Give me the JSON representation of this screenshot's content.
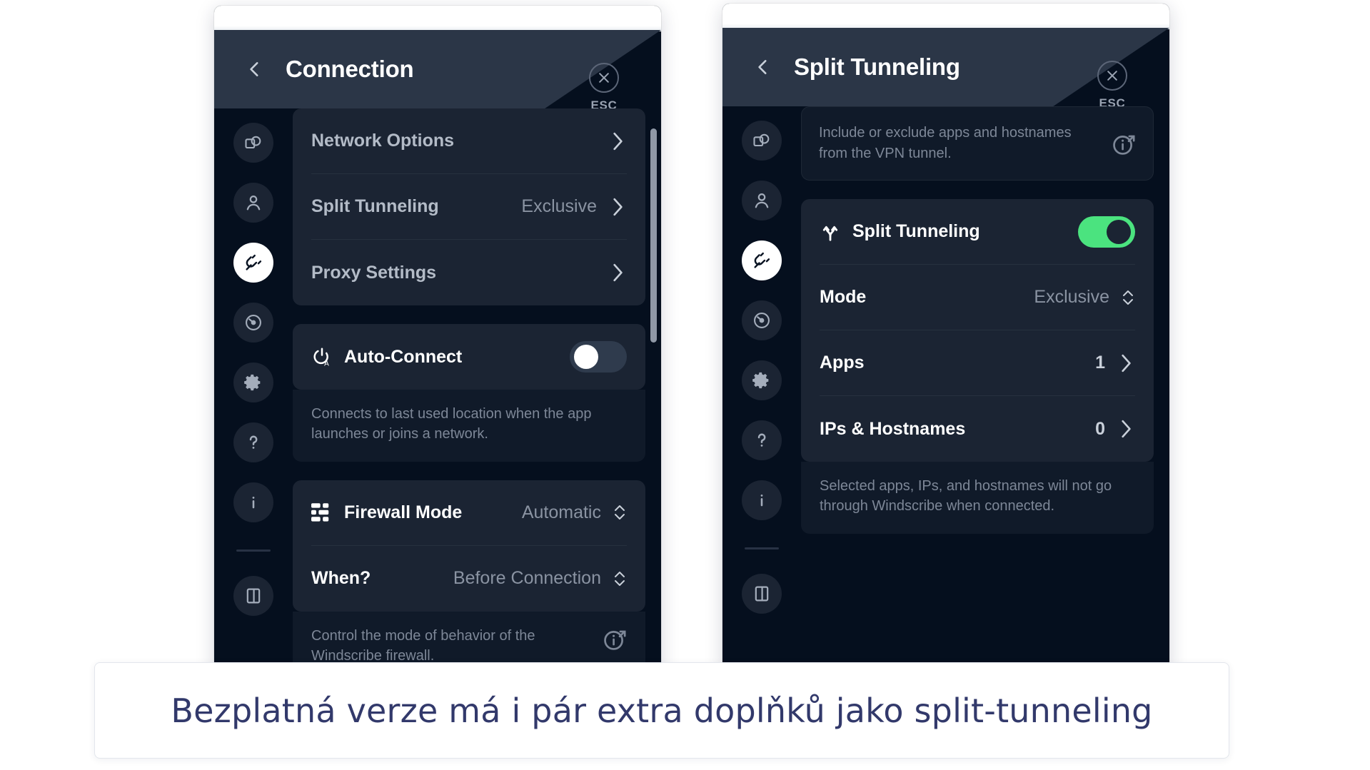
{
  "colors": {
    "accent_green": "#4BE37F",
    "window_bg": "#050F1E",
    "card_bg": "#1B2433",
    "header_bg": "#2B3647",
    "caption_text": "#32396B"
  },
  "left_window": {
    "header": {
      "back_label": "back-chevron",
      "title": "Connection",
      "esc_label": "ESC"
    },
    "rail": [
      {
        "name": "general",
        "icon": "windows-overlap-icon",
        "active": false
      },
      {
        "name": "account",
        "icon": "person-icon",
        "active": false
      },
      {
        "name": "connection",
        "icon": "plug-icon",
        "active": true
      },
      {
        "name": "robert",
        "icon": "robot-eye-icon",
        "active": false
      },
      {
        "name": "preferences",
        "icon": "gear-icon",
        "active": false
      },
      {
        "name": "help",
        "icon": "question-icon",
        "active": false
      },
      {
        "name": "about",
        "icon": "info-icon",
        "active": false
      },
      {
        "name": "logout",
        "icon": "door-exit-icon",
        "active": false
      }
    ],
    "nav_rows": [
      {
        "label": "Network Options",
        "value": "",
        "control": "chevron-right"
      },
      {
        "label": "Split Tunneling",
        "value": "Exclusive",
        "control": "chevron-right"
      },
      {
        "label": "Proxy Settings",
        "value": "",
        "control": "chevron-right"
      }
    ],
    "auto_connect": {
      "icon": "power-auto-icon",
      "label": "Auto-Connect",
      "toggle_on": false,
      "description": "Connects to last used location when the app launches or joins a network."
    },
    "firewall": {
      "icon": "firewall-bars-icon",
      "label": "Firewall Mode",
      "value": "Automatic",
      "when_label": "When?",
      "when_value": "Before Connection",
      "description": "Control the mode of behavior of the Windscribe firewall."
    }
  },
  "right_window": {
    "header": {
      "back_label": "back-chevron",
      "title": "Split Tunneling",
      "esc_label": "ESC"
    },
    "rail": [
      {
        "name": "general",
        "icon": "windows-overlap-icon",
        "active": false
      },
      {
        "name": "account",
        "icon": "person-icon",
        "active": false
      },
      {
        "name": "connection",
        "icon": "plug-icon",
        "active": true
      },
      {
        "name": "robert",
        "icon": "robot-eye-icon",
        "active": false
      },
      {
        "name": "preferences",
        "icon": "gear-icon",
        "active": false
      },
      {
        "name": "help",
        "icon": "question-icon",
        "active": false
      },
      {
        "name": "about",
        "icon": "info-icon",
        "active": false
      },
      {
        "name": "logout",
        "icon": "door-exit-icon",
        "active": false
      }
    ],
    "note": "Include or exclude apps and hostnames from the VPN tunnel.",
    "split_tunneling": {
      "icon": "split-fork-icon",
      "label": "Split Tunneling",
      "toggle_on": true
    },
    "rows": [
      {
        "label": "Mode",
        "value": "Exclusive",
        "control": "up-down-chevrons"
      },
      {
        "label": "Apps",
        "value": "1",
        "control": "chevron-right"
      },
      {
        "label": "IPs & Hostnames",
        "value": "0",
        "control": "chevron-right"
      }
    ],
    "footer_note": "Selected apps, IPs, and hostnames will not go through Windscribe when connected."
  },
  "caption": {
    "text": "Bezplatná verze má i pár extra doplňků jako split-tunneling"
  }
}
